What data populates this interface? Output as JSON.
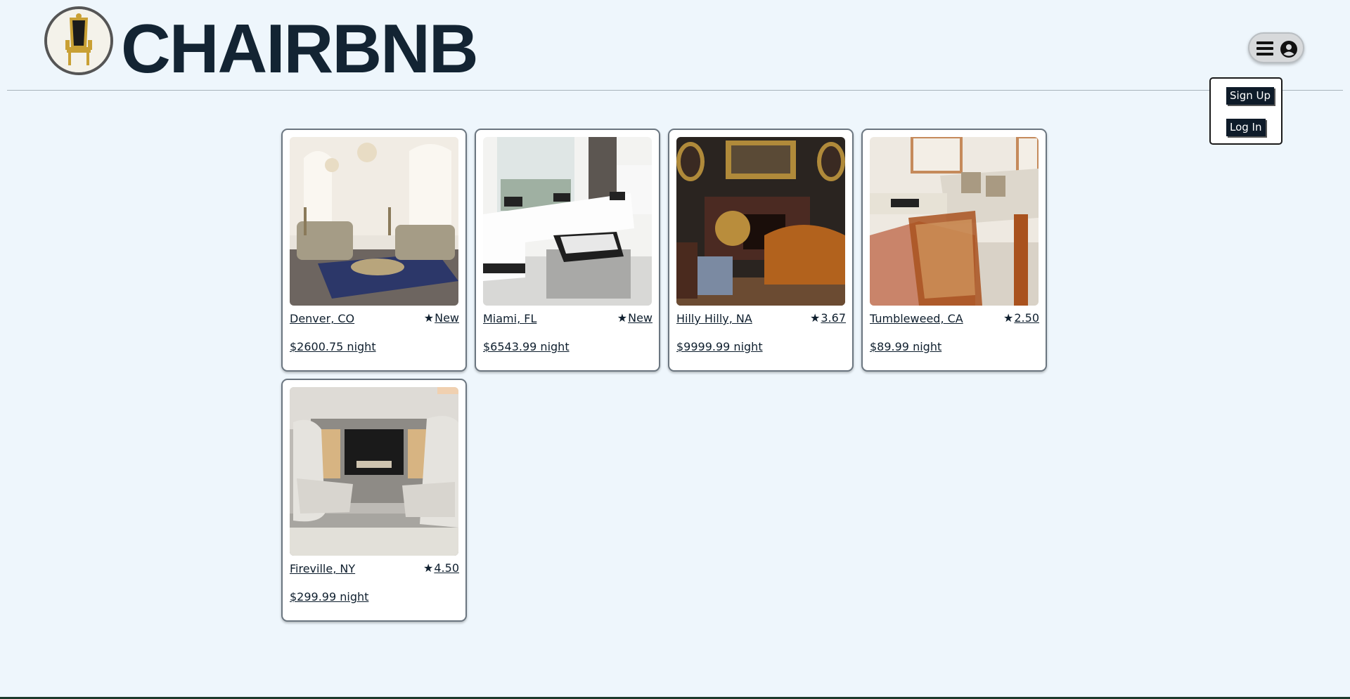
{
  "header": {
    "brand": "CHAIRBNB",
    "logo_icon": "throne-chair-logo-icon"
  },
  "menu": {
    "menu_icon": "hamburger-icon",
    "user_icon": "user-circle-icon",
    "sign_up": "Sign Up",
    "log_in": "Log In"
  },
  "listings": [
    {
      "location": "Denver, CO",
      "rating": "New",
      "price": "$2600.75 night",
      "photo": "ornate-living-room"
    },
    {
      "location": "Miami, FL",
      "rating": "New",
      "price": "$6543.99 night",
      "photo": "white-sectional-sofa"
    },
    {
      "location": "Hilly Hilly, NA",
      "rating": "3.67",
      "price": "$9999.99 night",
      "photo": "victorian-parlor"
    },
    {
      "location": "Tumbleweed, CA",
      "rating": "2.50",
      "price": "$89.99 night",
      "photo": "rattan-chairs-lounge"
    },
    {
      "location": "Fireville, NY",
      "rating": "4.50",
      "price": "$299.99 night",
      "photo": "fireplace-wingback-chairs"
    }
  ],
  "colors": {
    "background": "#eef6fc",
    "brand_text": "#132433",
    "button_dark": "#0e1b29"
  }
}
